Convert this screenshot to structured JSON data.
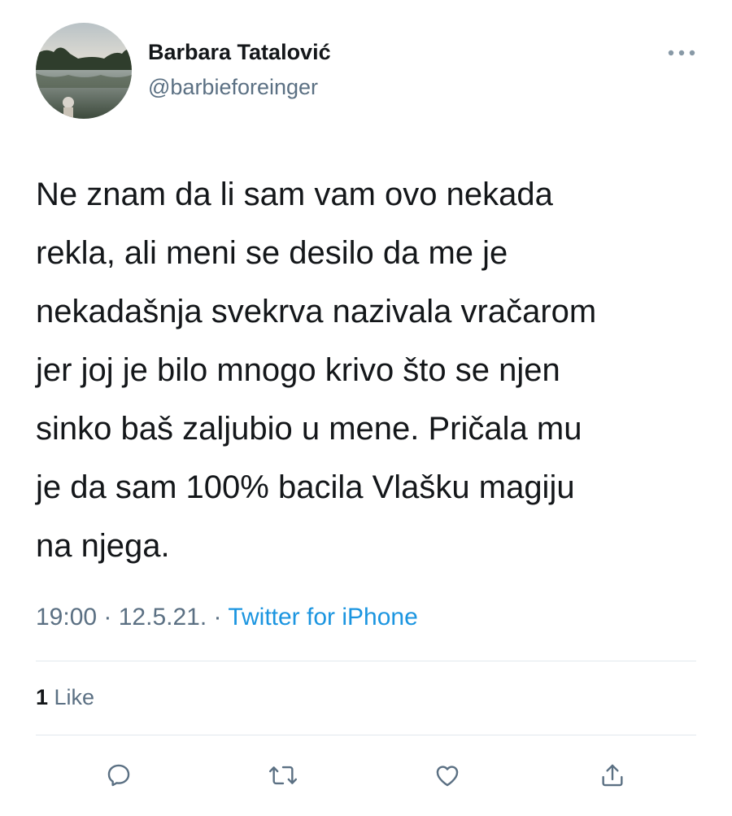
{
  "author": {
    "display_name": "Barbara Tatalović",
    "handle": "@barbieforeinger",
    "avatar_icon": "lake-landscape-photo"
  },
  "tweet": {
    "text": "Ne znam da li sam vam ovo nekada\nrekla, ali meni se desilo da me je\nnekadašnja svekrva nazivala vračarom\njer joj je bilo mnogo krivo što se njen\nsinko baš zaljubio u mene. Pričala mu\nje da sam 100% bacila Vlašku magiju\nna njega.",
    "time": "19:00",
    "separator": " · ",
    "date": "12.5.21.",
    "source": "Twitter for iPhone"
  },
  "engagement": {
    "like_count": "1",
    "like_label": " Like"
  },
  "actions": {
    "reply_icon": "reply-icon",
    "retweet_icon": "retweet-icon",
    "like_icon": "heart-icon",
    "share_icon": "share-icon"
  },
  "colors": {
    "link": "#1b95e0",
    "secondary_text": "#5b7083",
    "divider": "#e1e8ed"
  }
}
